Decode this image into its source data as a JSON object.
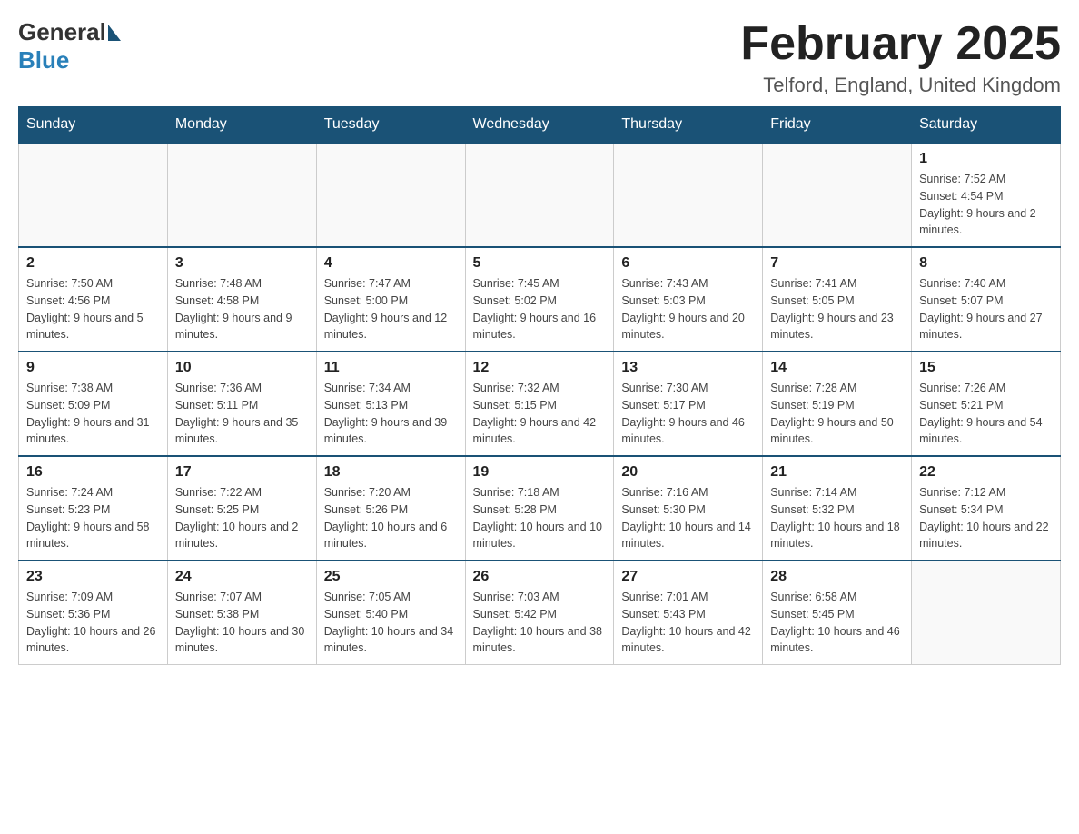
{
  "header": {
    "title": "February 2025",
    "location": "Telford, England, United Kingdom",
    "logo_general": "General",
    "logo_blue": "Blue"
  },
  "calendar": {
    "weekdays": [
      "Sunday",
      "Monday",
      "Tuesday",
      "Wednesday",
      "Thursday",
      "Friday",
      "Saturday"
    ],
    "weeks": [
      [
        {
          "day": "",
          "sunrise": "",
          "sunset": "",
          "daylight": ""
        },
        {
          "day": "",
          "sunrise": "",
          "sunset": "",
          "daylight": ""
        },
        {
          "day": "",
          "sunrise": "",
          "sunset": "",
          "daylight": ""
        },
        {
          "day": "",
          "sunrise": "",
          "sunset": "",
          "daylight": ""
        },
        {
          "day": "",
          "sunrise": "",
          "sunset": "",
          "daylight": ""
        },
        {
          "day": "",
          "sunrise": "",
          "sunset": "",
          "daylight": ""
        },
        {
          "day": "1",
          "sunrise": "Sunrise: 7:52 AM",
          "sunset": "Sunset: 4:54 PM",
          "daylight": "Daylight: 9 hours and 2 minutes."
        }
      ],
      [
        {
          "day": "2",
          "sunrise": "Sunrise: 7:50 AM",
          "sunset": "Sunset: 4:56 PM",
          "daylight": "Daylight: 9 hours and 5 minutes."
        },
        {
          "day": "3",
          "sunrise": "Sunrise: 7:48 AM",
          "sunset": "Sunset: 4:58 PM",
          "daylight": "Daylight: 9 hours and 9 minutes."
        },
        {
          "day": "4",
          "sunrise": "Sunrise: 7:47 AM",
          "sunset": "Sunset: 5:00 PM",
          "daylight": "Daylight: 9 hours and 12 minutes."
        },
        {
          "day": "5",
          "sunrise": "Sunrise: 7:45 AM",
          "sunset": "Sunset: 5:02 PM",
          "daylight": "Daylight: 9 hours and 16 minutes."
        },
        {
          "day": "6",
          "sunrise": "Sunrise: 7:43 AM",
          "sunset": "Sunset: 5:03 PM",
          "daylight": "Daylight: 9 hours and 20 minutes."
        },
        {
          "day": "7",
          "sunrise": "Sunrise: 7:41 AM",
          "sunset": "Sunset: 5:05 PM",
          "daylight": "Daylight: 9 hours and 23 minutes."
        },
        {
          "day": "8",
          "sunrise": "Sunrise: 7:40 AM",
          "sunset": "Sunset: 5:07 PM",
          "daylight": "Daylight: 9 hours and 27 minutes."
        }
      ],
      [
        {
          "day": "9",
          "sunrise": "Sunrise: 7:38 AM",
          "sunset": "Sunset: 5:09 PM",
          "daylight": "Daylight: 9 hours and 31 minutes."
        },
        {
          "day": "10",
          "sunrise": "Sunrise: 7:36 AM",
          "sunset": "Sunset: 5:11 PM",
          "daylight": "Daylight: 9 hours and 35 minutes."
        },
        {
          "day": "11",
          "sunrise": "Sunrise: 7:34 AM",
          "sunset": "Sunset: 5:13 PM",
          "daylight": "Daylight: 9 hours and 39 minutes."
        },
        {
          "day": "12",
          "sunrise": "Sunrise: 7:32 AM",
          "sunset": "Sunset: 5:15 PM",
          "daylight": "Daylight: 9 hours and 42 minutes."
        },
        {
          "day": "13",
          "sunrise": "Sunrise: 7:30 AM",
          "sunset": "Sunset: 5:17 PM",
          "daylight": "Daylight: 9 hours and 46 minutes."
        },
        {
          "day": "14",
          "sunrise": "Sunrise: 7:28 AM",
          "sunset": "Sunset: 5:19 PM",
          "daylight": "Daylight: 9 hours and 50 minutes."
        },
        {
          "day": "15",
          "sunrise": "Sunrise: 7:26 AM",
          "sunset": "Sunset: 5:21 PM",
          "daylight": "Daylight: 9 hours and 54 minutes."
        }
      ],
      [
        {
          "day": "16",
          "sunrise": "Sunrise: 7:24 AM",
          "sunset": "Sunset: 5:23 PM",
          "daylight": "Daylight: 9 hours and 58 minutes."
        },
        {
          "day": "17",
          "sunrise": "Sunrise: 7:22 AM",
          "sunset": "Sunset: 5:25 PM",
          "daylight": "Daylight: 10 hours and 2 minutes."
        },
        {
          "day": "18",
          "sunrise": "Sunrise: 7:20 AM",
          "sunset": "Sunset: 5:26 PM",
          "daylight": "Daylight: 10 hours and 6 minutes."
        },
        {
          "day": "19",
          "sunrise": "Sunrise: 7:18 AM",
          "sunset": "Sunset: 5:28 PM",
          "daylight": "Daylight: 10 hours and 10 minutes."
        },
        {
          "day": "20",
          "sunrise": "Sunrise: 7:16 AM",
          "sunset": "Sunset: 5:30 PM",
          "daylight": "Daylight: 10 hours and 14 minutes."
        },
        {
          "day": "21",
          "sunrise": "Sunrise: 7:14 AM",
          "sunset": "Sunset: 5:32 PM",
          "daylight": "Daylight: 10 hours and 18 minutes."
        },
        {
          "day": "22",
          "sunrise": "Sunrise: 7:12 AM",
          "sunset": "Sunset: 5:34 PM",
          "daylight": "Daylight: 10 hours and 22 minutes."
        }
      ],
      [
        {
          "day": "23",
          "sunrise": "Sunrise: 7:09 AM",
          "sunset": "Sunset: 5:36 PM",
          "daylight": "Daylight: 10 hours and 26 minutes."
        },
        {
          "day": "24",
          "sunrise": "Sunrise: 7:07 AM",
          "sunset": "Sunset: 5:38 PM",
          "daylight": "Daylight: 10 hours and 30 minutes."
        },
        {
          "day": "25",
          "sunrise": "Sunrise: 7:05 AM",
          "sunset": "Sunset: 5:40 PM",
          "daylight": "Daylight: 10 hours and 34 minutes."
        },
        {
          "day": "26",
          "sunrise": "Sunrise: 7:03 AM",
          "sunset": "Sunset: 5:42 PM",
          "daylight": "Daylight: 10 hours and 38 minutes."
        },
        {
          "day": "27",
          "sunrise": "Sunrise: 7:01 AM",
          "sunset": "Sunset: 5:43 PM",
          "daylight": "Daylight: 10 hours and 42 minutes."
        },
        {
          "day": "28",
          "sunrise": "Sunrise: 6:58 AM",
          "sunset": "Sunset: 5:45 PM",
          "daylight": "Daylight: 10 hours and 46 minutes."
        },
        {
          "day": "",
          "sunrise": "",
          "sunset": "",
          "daylight": ""
        }
      ]
    ]
  }
}
